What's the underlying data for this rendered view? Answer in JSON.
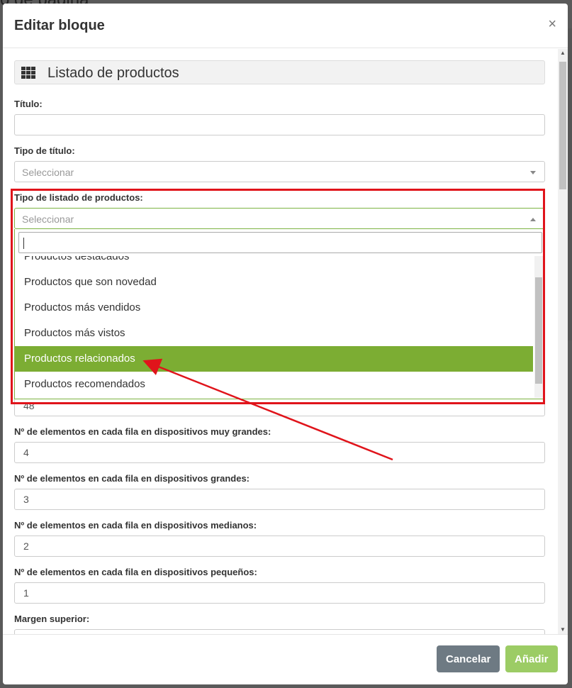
{
  "background": {
    "page_title": "o de pagina"
  },
  "modal": {
    "title": "Editar bloque",
    "close_glyph": "×"
  },
  "block": {
    "icon": "grid-icon",
    "title": "Listado de productos"
  },
  "fields": {
    "titulo": {
      "label": "Título:",
      "value": ""
    },
    "tipo_titulo": {
      "label": "Tipo de título:",
      "placeholder": "Seleccionar"
    },
    "tipo_listado": {
      "label": "Tipo de listado de productos:",
      "placeholder": "Seleccionar",
      "search_value": "",
      "options": [
        "Productos destacados",
        "Productos que son novedad",
        "Productos más vendidos",
        "Productos más vistos",
        "Productos relacionados",
        "Productos recomendados"
      ],
      "highlighted": "Productos relacionados"
    },
    "hidden_value": "48",
    "muy_grandes": {
      "label": "Nº de elementos en cada fila en dispositivos muy grandes:",
      "value": "4"
    },
    "grandes": {
      "label": "Nº de elementos en cada fila en dispositivos grandes:",
      "value": "3"
    },
    "medianos": {
      "label": "Nº de elementos en cada fila en dispositivos medianos:",
      "value": "2"
    },
    "pequenos": {
      "label": "Nº de elementos en cada fila en dispositivos pequeños:",
      "value": "1"
    },
    "margen_superior": {
      "label": "Margen superior:",
      "value": ""
    }
  },
  "footer": {
    "cancel_label": "Cancelar",
    "add_label": "Añadir"
  },
  "colors": {
    "accent_green": "#7cad33",
    "add_button": "#9ccc65",
    "cancel_button": "#6e7a83",
    "annotation_red": "#e0141b"
  }
}
